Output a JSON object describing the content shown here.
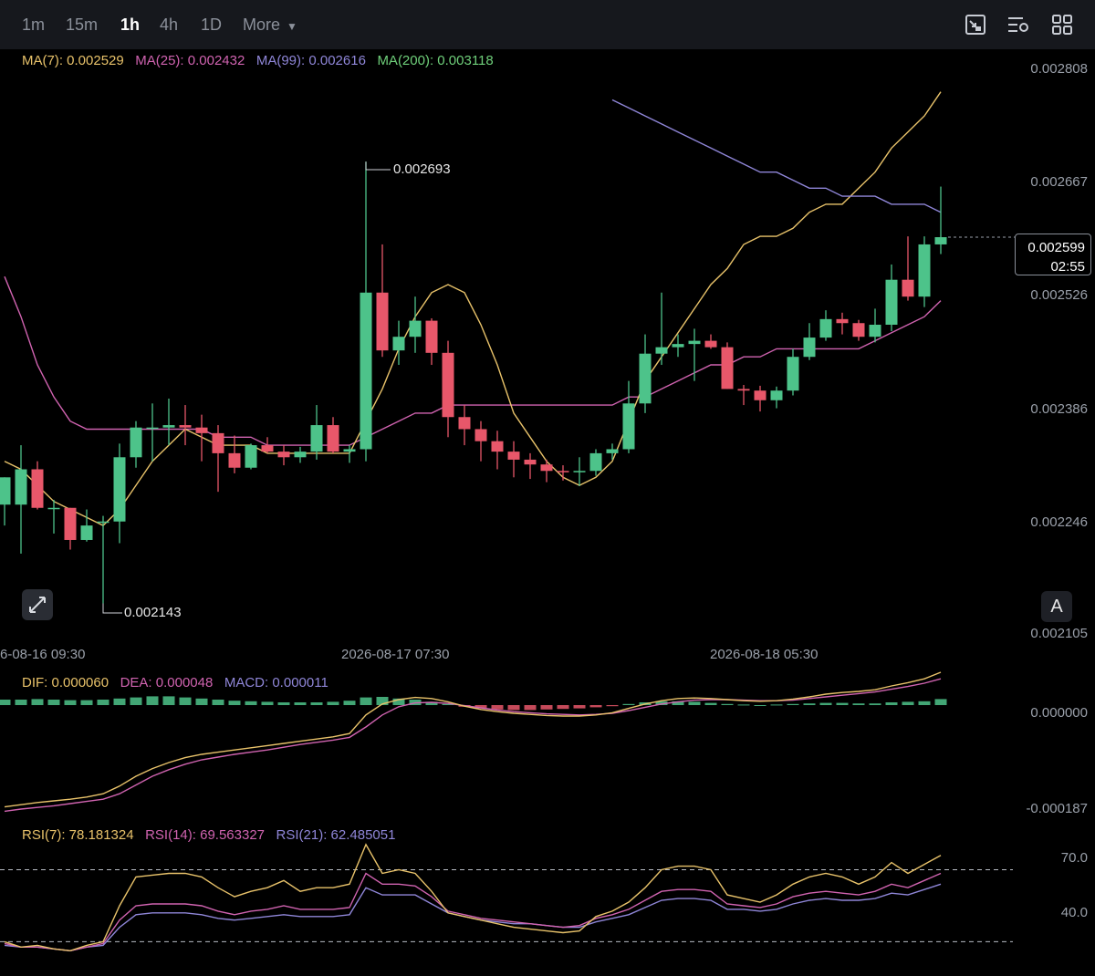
{
  "toolbar": {
    "timeframes": [
      "1m",
      "15m",
      "1h",
      "4h",
      "1D"
    ],
    "active": "1h",
    "more_label": "More"
  },
  "icons": [
    "chart-type-icon",
    "indicator-settings-icon",
    "layout-grid-icon",
    "expand-icon"
  ],
  "colors": {
    "up": "#4dc38a",
    "down": "#e8576a",
    "ma7": "#e8c26a",
    "ma25": "#d063b0",
    "ma99": "#8f86d8",
    "ma200": "#6fcf7a"
  },
  "legend": {
    "ma": [
      {
        "label": "MA(7): 0.002529",
        "color": "#e8c26a"
      },
      {
        "label": "MA(25): 0.002432",
        "color": "#d063b0"
      },
      {
        "label": "MA(99): 0.002616",
        "color": "#8f86d8"
      },
      {
        "label": "MA(200): 0.003118",
        "color": "#6fcf7a"
      }
    ],
    "macd": [
      {
        "label": "DIF: 0.000060",
        "color": "#e8c26a"
      },
      {
        "label": "DEA: 0.000048",
        "color": "#d063b0"
      },
      {
        "label": "MACD: 0.000011",
        "color": "#8f86d8"
      }
    ],
    "rsi": [
      {
        "label": "RSI(7): 78.181324",
        "color": "#e8c26a"
      },
      {
        "label": "RSI(14): 69.563327",
        "color": "#d063b0"
      },
      {
        "label": "RSI(21): 62.485051",
        "color": "#8f86d8"
      }
    ]
  },
  "current_price": {
    "price": "0.002599",
    "countdown": "02:55"
  },
  "auto_button": "A",
  "chart_data": [
    {
      "type": "candlestick",
      "y_axis_ticks": [
        "0.002808",
        "0.002667",
        "0.002526",
        "0.002386",
        "0.002246",
        "0.002105"
      ],
      "x_axis_ticks": [
        "6-08-16 09:30",
        "2026-08-17 07:30",
        "2026-08-18 05:30"
      ],
      "ylim": [
        0.002105,
        0.002808
      ],
      "annotations": {
        "high": "0.002693",
        "low": "0.002143"
      },
      "candles": [
        {
          "o": 0.002266,
          "h": 0.0023,
          "l": 0.00224,
          "c": 0.0023
        },
        {
          "o": 0.002266,
          "h": 0.00234,
          "l": 0.002205,
          "c": 0.00231
        },
        {
          "o": 0.00231,
          "h": 0.00232,
          "l": 0.00226,
          "c": 0.002262
        },
        {
          "o": 0.002262,
          "h": 0.002272,
          "l": 0.00223,
          "c": 0.002262
        },
        {
          "o": 0.002262,
          "h": 0.002262,
          "l": 0.00221,
          "c": 0.002222
        },
        {
          "o": 0.002222,
          "h": 0.00226,
          "l": 0.00222,
          "c": 0.00224
        },
        {
          "o": 0.002245,
          "h": 0.002252,
          "l": 0.002143,
          "c": 0.002245
        },
        {
          "o": 0.002245,
          "h": 0.002342,
          "l": 0.002218,
          "c": 0.002325
        },
        {
          "o": 0.002325,
          "h": 0.00237,
          "l": 0.002312,
          "c": 0.002362
        },
        {
          "o": 0.002362,
          "h": 0.002392,
          "l": 0.00232,
          "c": 0.002362
        },
        {
          "o": 0.002362,
          "h": 0.002398,
          "l": 0.00234,
          "c": 0.002365
        },
        {
          "o": 0.002365,
          "h": 0.00239,
          "l": 0.00234,
          "c": 0.002362
        },
        {
          "o": 0.002362,
          "h": 0.002378,
          "l": 0.00232,
          "c": 0.002355
        },
        {
          "o": 0.002355,
          "h": 0.002365,
          "l": 0.002282,
          "c": 0.00233
        },
        {
          "o": 0.00233,
          "h": 0.002352,
          "l": 0.002305,
          "c": 0.002312
        },
        {
          "o": 0.002312,
          "h": 0.002342,
          "l": 0.00231,
          "c": 0.00234
        },
        {
          "o": 0.00234,
          "h": 0.00235,
          "l": 0.00233,
          "c": 0.002332
        },
        {
          "o": 0.002332,
          "h": 0.00234,
          "l": 0.002315,
          "c": 0.002325
        },
        {
          "o": 0.002325,
          "h": 0.002338,
          "l": 0.002318,
          "c": 0.002332
        },
        {
          "o": 0.002332,
          "h": 0.00239,
          "l": 0.002322,
          "c": 0.002365
        },
        {
          "o": 0.002365,
          "h": 0.002375,
          "l": 0.00233,
          "c": 0.002332
        },
        {
          "o": 0.002332,
          "h": 0.00234,
          "l": 0.002318,
          "c": 0.002335
        },
        {
          "o": 0.002335,
          "h": 0.002693,
          "l": 0.00232,
          "c": 0.00253
        },
        {
          "o": 0.00253,
          "h": 0.00259,
          "l": 0.00245,
          "c": 0.002458
        },
        {
          "o": 0.002458,
          "h": 0.002495,
          "l": 0.00244,
          "c": 0.002475
        },
        {
          "o": 0.002475,
          "h": 0.002525,
          "l": 0.002455,
          "c": 0.002495
        },
        {
          "o": 0.002495,
          "h": 0.002498,
          "l": 0.00244,
          "c": 0.002455
        },
        {
          "o": 0.002455,
          "h": 0.00247,
          "l": 0.00235,
          "c": 0.002375
        },
        {
          "o": 0.002375,
          "h": 0.00239,
          "l": 0.00234,
          "c": 0.00236
        },
        {
          "o": 0.00236,
          "h": 0.00237,
          "l": 0.00232,
          "c": 0.002345
        },
        {
          "o": 0.002345,
          "h": 0.002358,
          "l": 0.00231,
          "c": 0.002332
        },
        {
          "o": 0.002332,
          "h": 0.002345,
          "l": 0.0023,
          "c": 0.002322
        },
        {
          "o": 0.002322,
          "h": 0.00233,
          "l": 0.002298,
          "c": 0.002316
        },
        {
          "o": 0.002316,
          "h": 0.002322,
          "l": 0.002294,
          "c": 0.002308
        },
        {
          "o": 0.002308,
          "h": 0.002315,
          "l": 0.002296,
          "c": 0.002307
        },
        {
          "o": 0.002307,
          "h": 0.002325,
          "l": 0.002289,
          "c": 0.002308
        },
        {
          "o": 0.002308,
          "h": 0.002335,
          "l": 0.002302,
          "c": 0.00233
        },
        {
          "o": 0.00233,
          "h": 0.002342,
          "l": 0.002322,
          "c": 0.002335
        },
        {
          "o": 0.002335,
          "h": 0.00242,
          "l": 0.00233,
          "c": 0.002392
        },
        {
          "o": 0.002392,
          "h": 0.002478,
          "l": 0.00238,
          "c": 0.002454
        },
        {
          "o": 0.002454,
          "h": 0.00253,
          "l": 0.00244,
          "c": 0.002462
        },
        {
          "o": 0.002462,
          "h": 0.002478,
          "l": 0.00245,
          "c": 0.002466
        },
        {
          "o": 0.002466,
          "h": 0.002485,
          "l": 0.00242,
          "c": 0.00247
        },
        {
          "o": 0.00247,
          "h": 0.002478,
          "l": 0.00246,
          "c": 0.002462
        },
        {
          "o": 0.002462,
          "h": 0.002468,
          "l": 0.00241,
          "c": 0.00241
        },
        {
          "o": 0.00241,
          "h": 0.002415,
          "l": 0.00239,
          "c": 0.002408
        },
        {
          "o": 0.002408,
          "h": 0.002414,
          "l": 0.002382,
          "c": 0.002396
        },
        {
          "o": 0.002396,
          "h": 0.002413,
          "l": 0.002386,
          "c": 0.002408
        },
        {
          "o": 0.002408,
          "h": 0.00246,
          "l": 0.002402,
          "c": 0.00245
        },
        {
          "o": 0.00245,
          "h": 0.002492,
          "l": 0.002446,
          "c": 0.002474
        },
        {
          "o": 0.002474,
          "h": 0.002508,
          "l": 0.00247,
          "c": 0.002497
        },
        {
          "o": 0.002497,
          "h": 0.002505,
          "l": 0.002478,
          "c": 0.002492
        },
        {
          "o": 0.002492,
          "h": 0.002496,
          "l": 0.00247,
          "c": 0.002475
        },
        {
          "o": 0.002475,
          "h": 0.00251,
          "l": 0.002468,
          "c": 0.00249
        },
        {
          "o": 0.00249,
          "h": 0.002565,
          "l": 0.002482,
          "c": 0.002546
        },
        {
          "o": 0.002546,
          "h": 0.0026,
          "l": 0.00252,
          "c": 0.002525
        },
        {
          "o": 0.002525,
          "h": 0.0026,
          "l": 0.002512,
          "c": 0.00259
        },
        {
          "o": 0.00259,
          "h": 0.002662,
          "l": 0.002578,
          "c": 0.002599
        }
      ],
      "ma7": [
        0.00232,
        0.00231,
        0.00229,
        0.00227,
        0.00226,
        0.00225,
        0.00224,
        0.00226,
        0.00229,
        0.00232,
        0.00234,
        0.00236,
        0.00235,
        0.00234,
        0.00234,
        0.00234,
        0.00233,
        0.00233,
        0.00233,
        0.00233,
        0.00233,
        0.00233,
        0.00237,
        0.00241,
        0.00246,
        0.0025,
        0.00253,
        0.00254,
        0.00253,
        0.00249,
        0.00244,
        0.00238,
        0.00235,
        0.00232,
        0.0023,
        0.00229,
        0.0023,
        0.00232,
        0.00237,
        0.00242,
        0.00245,
        0.00248,
        0.00251,
        0.00254,
        0.00256,
        0.00259,
        0.0026,
        0.0026,
        0.00261,
        0.00263,
        0.00264,
        0.00264,
        0.00266,
        0.00268,
        0.00271,
        0.00273,
        0.00275,
        0.00278
      ],
      "ma25": [
        0.00255,
        0.0025,
        0.00244,
        0.0024,
        0.00237,
        0.00236,
        0.00236,
        0.00236,
        0.00236,
        0.00236,
        0.00236,
        0.00236,
        0.00236,
        0.00235,
        0.00235,
        0.00235,
        0.00234,
        0.00234,
        0.00234,
        0.00234,
        0.00234,
        0.00234,
        0.00235,
        0.00236,
        0.00237,
        0.00238,
        0.00238,
        0.00239,
        0.00239,
        0.00239,
        0.00239,
        0.00239,
        0.00239,
        0.00239,
        0.00239,
        0.00239,
        0.00239,
        0.00239,
        0.0024,
        0.0024,
        0.00241,
        0.00242,
        0.00243,
        0.00244,
        0.00244,
        0.00245,
        0.00245,
        0.00246,
        0.00246,
        0.00246,
        0.00246,
        0.00246,
        0.00246,
        0.00247,
        0.00248,
        0.00249,
        0.0025,
        0.00252
      ],
      "ma99_start_index": 37,
      "ma99": [
        0.00277,
        0.00276,
        0.00275,
        0.00274,
        0.00273,
        0.00272,
        0.00271,
        0.0027,
        0.00269,
        0.00268,
        0.00268,
        0.00267,
        0.00266,
        0.00266,
        0.00265,
        0.00265,
        0.00265,
        0.00264,
        0.00264,
        0.00264,
        0.00263
      ],
      "x_tick_indices": [
        0,
        22,
        44
      ]
    },
    {
      "type": "bar+line",
      "name": "MACD",
      "y_axis_ticks": [
        "0.000000",
        "-0.000187"
      ],
      "ylim": [
        -0.0002,
        3e-05
      ],
      "hist": [
        1e-05,
        1e-05,
        1.1e-05,
        1e-05,
        9e-06,
        9e-06,
        1e-05,
        1.2e-05,
        1.4e-05,
        1.6e-05,
        1.6e-05,
        1.4e-05,
        1.2e-05,
        1e-05,
        8e-06,
        7e-06,
        6e-06,
        5e-06,
        5e-06,
        5e-06,
        6e-06,
        8e-06,
        1.4e-05,
        1.5e-05,
        1.2e-05,
        1e-05,
        6e-06,
        2e-06,
        -3e-06,
        -6e-06,
        -8e-06,
        -9e-06,
        -9e-06,
        -8e-06,
        -7e-06,
        -6e-06,
        -4e-06,
        -2e-06,
        2e-06,
        5e-06,
        7e-06,
        7e-06,
        6e-06,
        4e-06,
        2e-06,
        1e-06,
        0.0,
        1e-06,
        2e-06,
        3e-06,
        4e-06,
        4e-06,
        3e-06,
        3e-06,
        5e-06,
        6e-06,
        7e-06,
        1.1e-05
      ],
      "dif": [
        -0.000186,
        -0.000182,
        -0.000178,
        -0.000175,
        -0.000172,
        -0.000168,
        -0.000162,
        -0.000148,
        -0.00013,
        -0.000116,
        -0.000105,
        -9.6e-05,
        -9e-05,
        -8.6e-05,
        -8.2e-05,
        -7.8e-05,
        -7.4e-05,
        -7e-05,
        -6.6e-05,
        -6.2e-05,
        -5.8e-05,
        -5.2e-05,
        -1.8e-05,
        2e-06,
        1e-05,
        1.4e-05,
        1.2e-05,
        6e-06,
        -2e-06,
        -8e-06,
        -1.2e-05,
        -1.5e-05,
        -1.7e-05,
        -1.9e-05,
        -2e-05,
        -2e-05,
        -1.8e-05,
        -1.4e-05,
        -6e-06,
        2e-06,
        8e-06,
        1.2e-05,
        1.3e-05,
        1.2e-05,
        1e-05,
        8e-06,
        7e-06,
        8e-06,
        1.1e-05,
        1.5e-05,
        2e-05,
        2.3e-05,
        2.5e-05,
        2.8e-05,
        3.5e-05,
        4.1e-05,
        4.8e-05,
        6e-05
      ],
      "dea": [
        -0.000194,
        -0.00019,
        -0.000187,
        -0.000184,
        -0.00018,
        -0.000176,
        -0.000172,
        -0.000162,
        -0.000146,
        -0.00013,
        -0.000118,
        -0.000108,
        -0.0001,
        -9.5e-05,
        -9e-05,
        -8.6e-05,
        -8.2e-05,
        -7.7e-05,
        -7.2e-05,
        -6.8e-05,
        -6.4e-05,
        -5.9e-05,
        -4e-05,
        -1.8e-05,
        -3e-06,
        4e-06,
        5e-06,
        3e-06,
        -1e-06,
        -5e-06,
        -9e-06,
        -1.2e-05,
        -1.4e-05,
        -1.6e-05,
        -1.7e-05,
        -1.8e-05,
        -1.7e-05,
        -1.5e-05,
        -1e-05,
        -4e-06,
        2e-06,
        6e-06,
        9e-06,
        1e-05,
        1e-05,
        9e-06,
        8e-06,
        8e-06,
        9e-06,
        1.2e-05,
        1.5e-05,
        1.8e-05,
        2.1e-05,
        2.4e-05,
        2.9e-05,
        3.4e-05,
        4e-05,
        4.8e-05
      ]
    },
    {
      "type": "line",
      "name": "RSI",
      "y_axis_ticks": [
        "70.0",
        "40.0"
      ],
      "ylim": [
        15,
        88
      ],
      "ref_lines": [
        70,
        30
      ],
      "rsi7": [
        30,
        27,
        28,
        26,
        25,
        28,
        30,
        50,
        66,
        67,
        68,
        68,
        66,
        60,
        55,
        58,
        60,
        64,
        58,
        60,
        60,
        62,
        84,
        68,
        70,
        68,
        58,
        46,
        44,
        42,
        40,
        38,
        37,
        36,
        35,
        36,
        44,
        47,
        52,
        60,
        70,
        72,
        72,
        70,
        56,
        54,
        52,
        56,
        62,
        66,
        68,
        66,
        62,
        66,
        74,
        68,
        73,
        78
      ],
      "rsi14": [
        29,
        27,
        27,
        26,
        25,
        27,
        29,
        42,
        50,
        51,
        51,
        51,
        50,
        47,
        45,
        47,
        48,
        50,
        48,
        48,
        48,
        49,
        68,
        62,
        62,
        61,
        55,
        47,
        45,
        43,
        42,
        41,
        40,
        39,
        38,
        39,
        43,
        45,
        48,
        53,
        58,
        59,
        59,
        58,
        51,
        50,
        49,
        51,
        55,
        57,
        58,
        57,
        56,
        58,
        62,
        60,
        64,
        68
      ],
      "rsi21": [
        28,
        27,
        27,
        26,
        25,
        27,
        28,
        38,
        45,
        46,
        46,
        46,
        45,
        43,
        42,
        43,
        44,
        45,
        44,
        44,
        44,
        45,
        60,
        56,
        56,
        56,
        51,
        46,
        44,
        42,
        41,
        40,
        40,
        39,
        38,
        38,
        41,
        43,
        45,
        49,
        53,
        54,
        54,
        53,
        48,
        48,
        47,
        48,
        51,
        53,
        54,
        53,
        53,
        54,
        57,
        56,
        59,
        62
      ]
    }
  ]
}
